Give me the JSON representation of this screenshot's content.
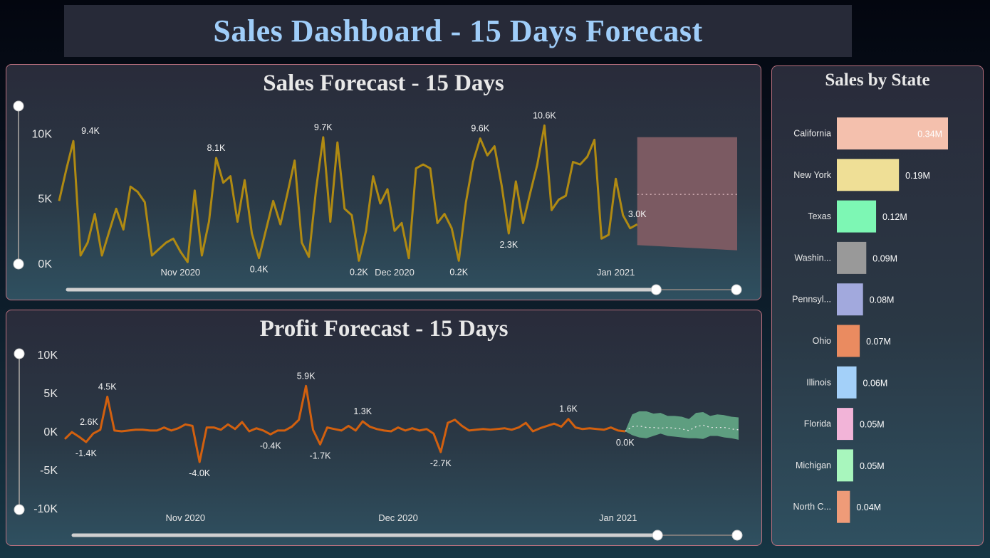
{
  "dashboard_title": "Sales Dashboard - 15 Days Forecast",
  "colors": {
    "sales_line": "#b08a12",
    "sales_forecast_band": "#7b5a62",
    "profit_line": "#d2600f",
    "profit_forecast_band": "#5e9e80",
    "panel_border": "#b9707e",
    "title_text": "#9fcdf9"
  },
  "chart_data": [
    {
      "id": "sales",
      "type": "line",
      "title": "Sales Forecast - 15 Days",
      "y_ticks": [
        {
          "v": 0,
          "label": "0K"
        },
        {
          "v": 5000,
          "label": "5K"
        },
        {
          "v": 10000,
          "label": "10K"
        }
      ],
      "ylim": [
        0,
        11000
      ],
      "x_ticks": [
        {
          "i": 17,
          "label": "Nov 2020"
        },
        {
          "i": 47,
          "label": "Dec 2020"
        },
        {
          "i": 78,
          "label": "Jan 2021"
        }
      ],
      "x_count": 96,
      "series": [
        {
          "values": [
            4800,
            7200,
            9400,
            600,
            1600,
            3800,
            600,
            2400,
            4200,
            2600,
            5900,
            5500,
            4700,
            600,
            1100,
            1600,
            1900,
            900,
            100,
            5600,
            600,
            3200,
            8100,
            6200,
            6700,
            3200,
            6400,
            2300,
            400,
            2600,
            4800,
            3000,
            5400,
            7900,
            1600,
            500,
            5700,
            9700,
            3200,
            9300,
            4200,
            3700,
            200,
            2500,
            6700,
            4600,
            5700,
            2500,
            3100,
            400,
            7300,
            7600,
            7300,
            3100,
            3800,
            2700,
            200,
            4700,
            7800,
            9600,
            8300,
            9000,
            6000,
            2300,
            6300,
            3100,
            5400,
            7600,
            10600,
            4100,
            4900,
            5200,
            7800,
            7600,
            8200,
            9500,
            1900,
            2200,
            6500,
            3700,
            2700,
            3000
          ],
          "label_points": [
            {
              "i": 2,
              "label": "9.4K"
            },
            {
              "i": 22,
              "label": "8.1K"
            },
            {
              "i": 28,
              "label": "0.4K"
            },
            {
              "i": 37,
              "label": "9.7K"
            },
            {
              "i": 42,
              "label": "0.2K"
            },
            {
              "i": 56,
              "label": "0.2K"
            },
            {
              "i": 59,
              "label": "9.6K"
            },
            {
              "i": 63,
              "label": "2.3K"
            },
            {
              "i": 68,
              "label": "10.6K"
            },
            {
              "i": 81,
              "label": "3.0K"
            }
          ]
        }
      ],
      "forecast": {
        "start_i": 81,
        "end_i": 95,
        "upper_start": 9700,
        "upper_end": 9700,
        "lower_start": 1400,
        "lower_end": 1000,
        "mid_start": 5300,
        "mid_end": 5300
      },
      "x_slider": {
        "start": 0.88,
        "end": 1.0
      },
      "y_slider": {
        "start": 0.0,
        "end": 1.0
      }
    },
    {
      "id": "profit",
      "type": "line",
      "title": "Profit Forecast - 15 Days",
      "y_ticks": [
        {
          "v": -10000,
          "label": "-10K"
        },
        {
          "v": -5000,
          "label": "-5K"
        },
        {
          "v": 0,
          "label": "0K"
        },
        {
          "v": 5000,
          "label": "5K"
        },
        {
          "v": 10000,
          "label": "10K"
        }
      ],
      "ylim": [
        -10000,
        10000
      ],
      "x_ticks": [
        {
          "i": 17,
          "label": "Nov 2020"
        },
        {
          "i": 47,
          "label": "Dec 2020"
        },
        {
          "i": 78,
          "label": "Jan 2021"
        }
      ],
      "x_count": 96,
      "series": [
        {
          "values": [
            -1000,
            -100,
            -700,
            -1400,
            -300,
            200,
            4500,
            100,
            0,
            100,
            200,
            200,
            100,
            100,
            500,
            100,
            400,
            900,
            700,
            -4000,
            500,
            500,
            200,
            900,
            300,
            1200,
            0,
            400,
            100,
            -400,
            100,
            100,
            600,
            1500,
            5900,
            200,
            -1700,
            500,
            300,
            100,
            700,
            100,
            1300,
            600,
            300,
            100,
            0,
            500,
            100,
            400,
            100,
            300,
            -300,
            -2700,
            1100,
            1500,
            700,
            100,
            200,
            300,
            200,
            300,
            400,
            200,
            500,
            1100,
            0,
            400,
            700,
            1000,
            600,
            1600,
            500,
            300,
            400,
            300,
            200,
            500,
            100,
            0
          ],
          "label_points": [
            {
              "i": 1,
              "label": "2.6K"
            },
            {
              "i": 3,
              "label": "-1.4K"
            },
            {
              "i": 6,
              "label": "4.5K"
            },
            {
              "i": 19,
              "label": "-4.0K"
            },
            {
              "i": 29,
              "label": "-0.4K"
            },
            {
              "i": 34,
              "label": "5.9K"
            },
            {
              "i": 36,
              "label": "-1.7K"
            },
            {
              "i": 42,
              "label": "1.3K"
            },
            {
              "i": 53,
              "label": "-2.7K"
            },
            {
              "i": 71,
              "label": "1.6K"
            },
            {
              "i": 79,
              "label": "0.0K"
            }
          ]
        }
      ],
      "forecast": {
        "start_i": 79,
        "end_i": 95,
        "upper": [
          0,
          2200,
          2600,
          2600,
          2300,
          2400,
          2000,
          2000,
          1900,
          1600,
          2400,
          2500,
          2000,
          2200,
          2100,
          1900,
          1800
        ],
        "lower": [
          0,
          -500,
          -800,
          -900,
          -600,
          -300,
          -600,
          -700,
          -800,
          -900,
          -900,
          -1000,
          -600,
          -600,
          -800,
          -900,
          -1100
        ],
        "mid": [
          0,
          600,
          700,
          500,
          500,
          400,
          500,
          400,
          300,
          100,
          600,
          800,
          500,
          500,
          500,
          300,
          200
        ]
      },
      "x_slider": {
        "start": 0.88,
        "end": 1.0
      },
      "y_slider": {
        "start": 0.0,
        "end": 1.0
      }
    },
    {
      "id": "state",
      "type": "bar",
      "title": "Sales by State",
      "categories": [
        "California",
        "New York",
        "Texas",
        "Washin...",
        "Pennsyl...",
        "Ohio",
        "Illinois",
        "Florida",
        "Michigan",
        "North C..."
      ],
      "values": [
        0.34,
        0.19,
        0.12,
        0.09,
        0.08,
        0.07,
        0.06,
        0.05,
        0.05,
        0.04
      ],
      "labels": [
        "0.34M",
        "0.19M",
        "0.12M",
        "0.09M",
        "0.08M",
        "0.07M",
        "0.06M",
        "0.05M",
        "0.05M",
        "0.04M"
      ],
      "colors": [
        "#f4c0ad",
        "#efdf96",
        "#7df7b4",
        "#999999",
        "#a2a9dd",
        "#ea8b60",
        "#a3d0f9",
        "#f2b4d8",
        "#a8f6bd",
        "#ef9b78"
      ],
      "xlim": [
        0,
        0.34
      ]
    }
  ]
}
